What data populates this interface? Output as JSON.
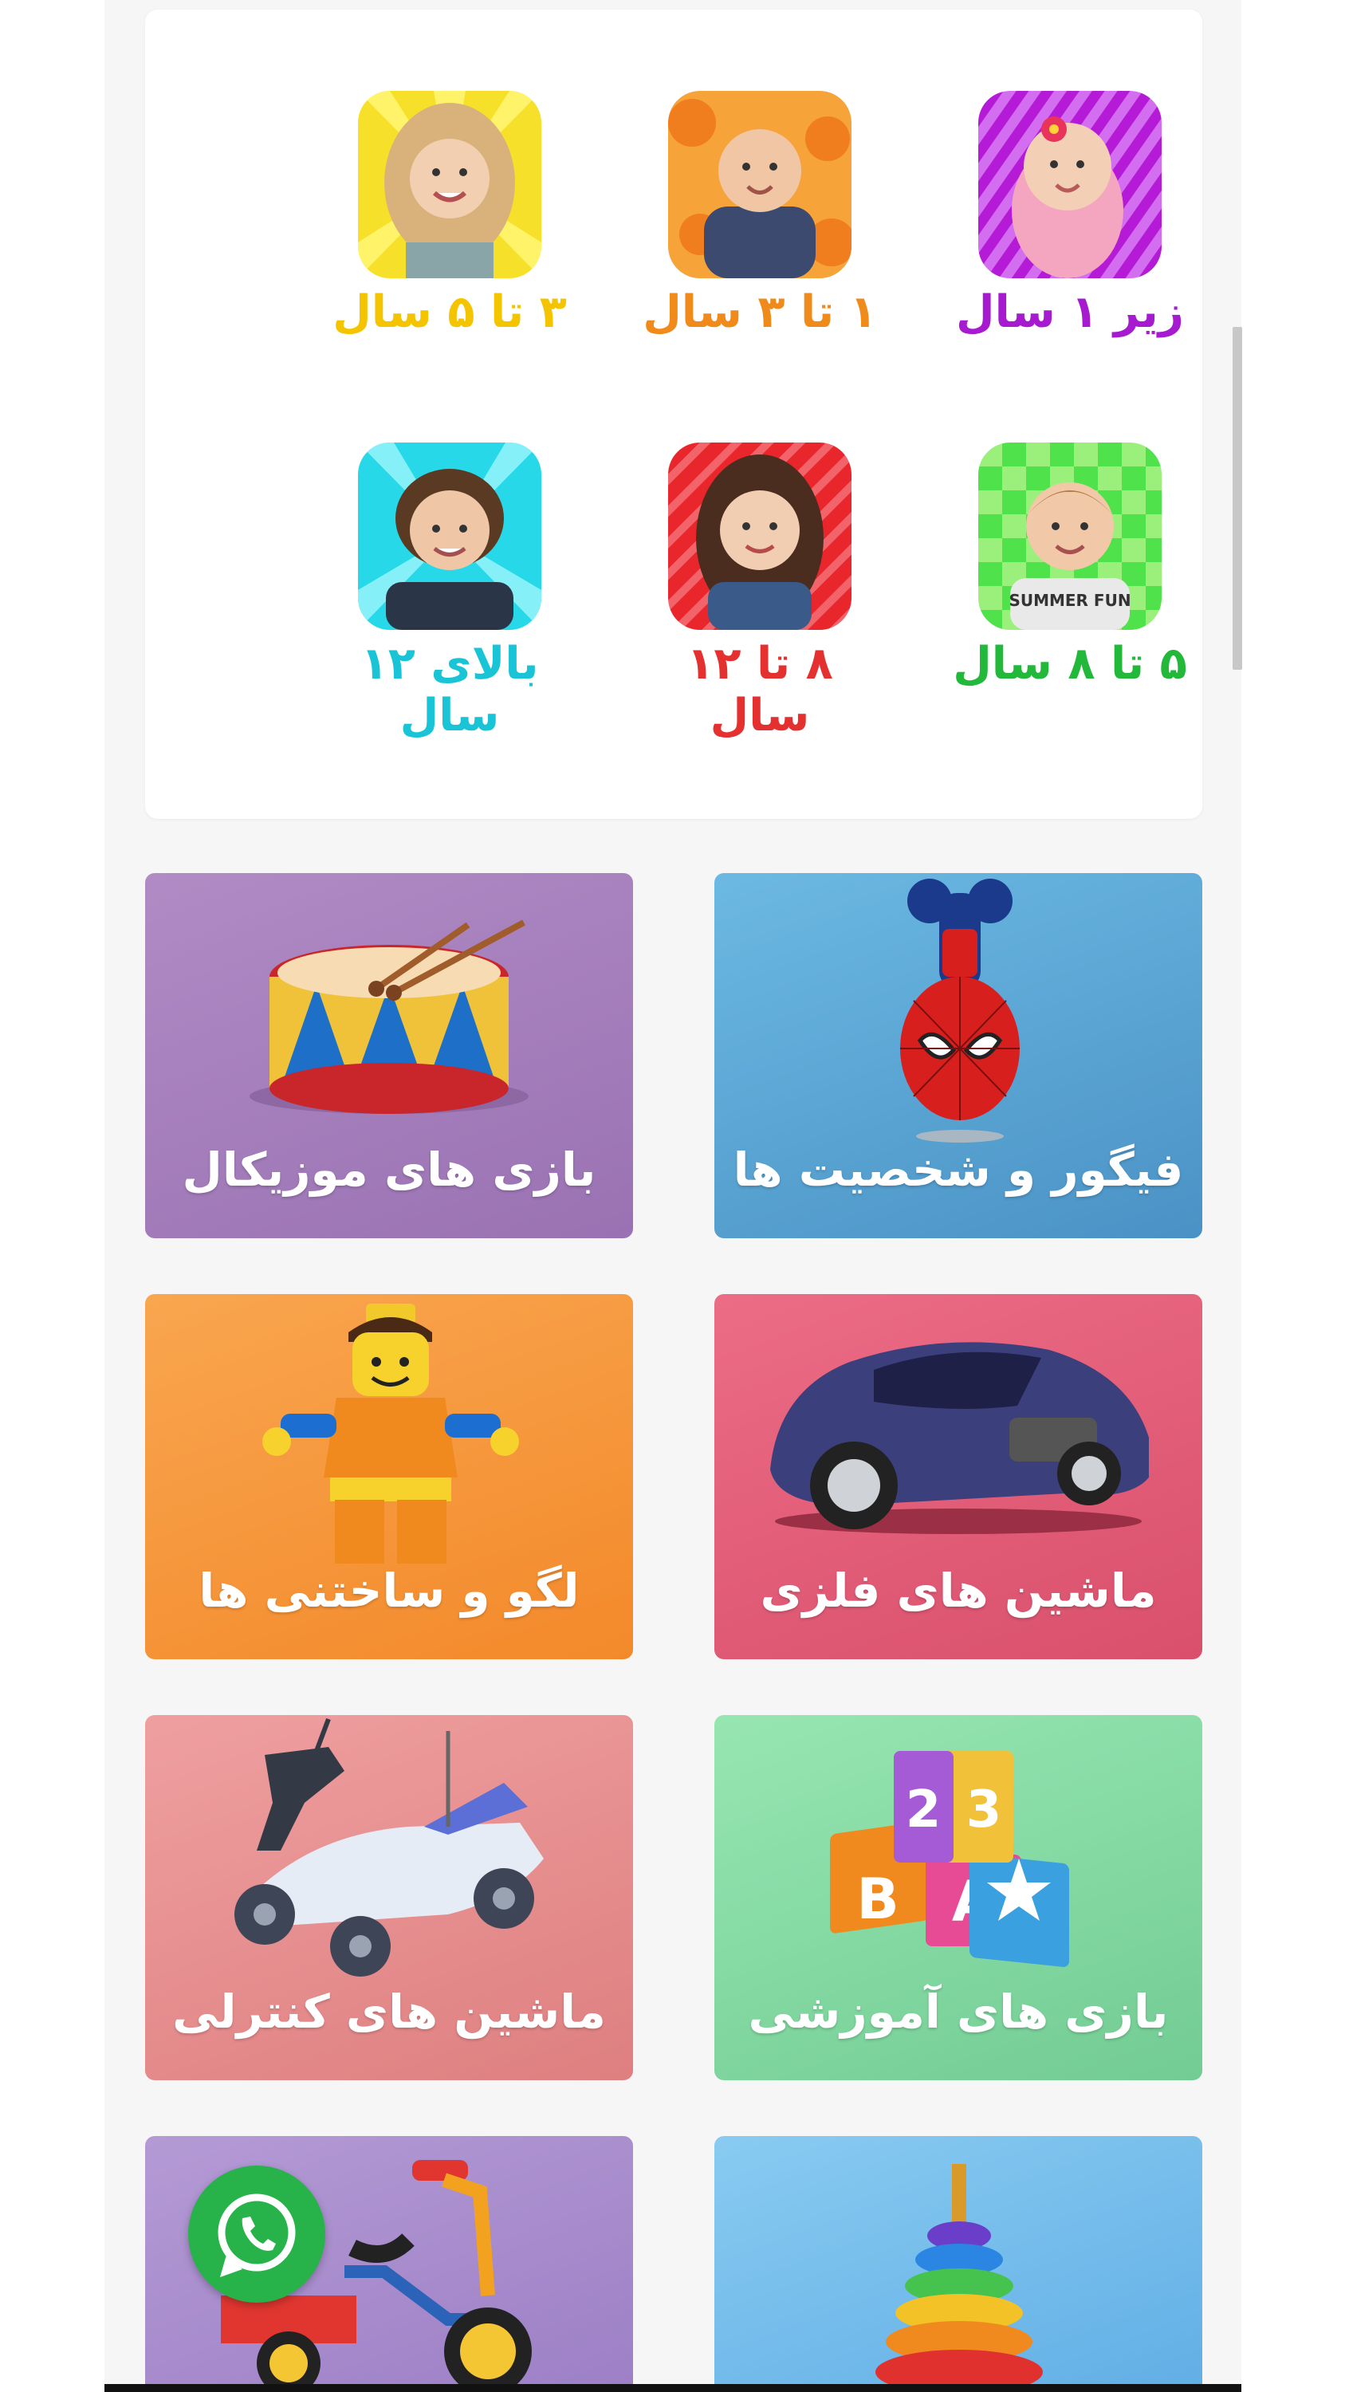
{
  "age_groups": [
    {
      "label": "زیر ۱ سال",
      "color": "#a61bd0",
      "thumb": "baby-girl-photo"
    },
    {
      "label": "۱ تا ۳ سال",
      "color": "#f08a1a",
      "thumb": "toddler-boy-photo"
    },
    {
      "label": "۳ تا ۵ سال",
      "color": "#f4c400",
      "thumb": "curly-girl-photo"
    },
    {
      "label": "۵ تا ۸ سال",
      "color": "#22b83a",
      "thumb": "boy-photo"
    },
    {
      "label": "۸ تا ۱۲ سال",
      "color": "#e53030",
      "thumb": "girl-photo"
    },
    {
      "label": "بالای ۱۲ سال",
      "color": "#19c4d6",
      "thumb": "teen-boy-photo"
    }
  ],
  "categories": [
    {
      "label": "فیگور و شخصیت ها",
      "color_top": "#63b3df",
      "color_bottom": "#4a95c7",
      "icon": "spiderman-figure-icon"
    },
    {
      "label": "بازی های موزیکال",
      "color_top": "#b08bc4",
      "color_bottom": "#9a72b3",
      "icon": "drum-icon"
    },
    {
      "label": "ماشین های فلزی",
      "color_top": "#ea6682",
      "color_bottom": "#d9506c",
      "icon": "sports-car-icon"
    },
    {
      "label": "لگو و ساختنی ها",
      "color_top": "#f9a24e",
      "color_bottom": "#f3892a",
      "icon": "lego-figure-icon"
    },
    {
      "label": "بازی های آموزشی",
      "color_top": "#93e3ad",
      "color_bottom": "#72cc93",
      "icon": "abc-blocks-icon"
    },
    {
      "label": "ماشین های کنترلی",
      "color_top": "#ee9c9c",
      "color_bottom": "#de7f80",
      "icon": "rc-car-icon"
    },
    {
      "label": "",
      "color_top": "#85c8f0",
      "color_bottom": "#62afe6",
      "icon": "stacking-rings-icon"
    },
    {
      "label": "",
      "color_top": "#b398d4",
      "color_bottom": "#9d80c6",
      "icon": "tricycle-icon"
    }
  ],
  "fab": {
    "icon": "whatsapp-icon",
    "color": "#27b349"
  }
}
